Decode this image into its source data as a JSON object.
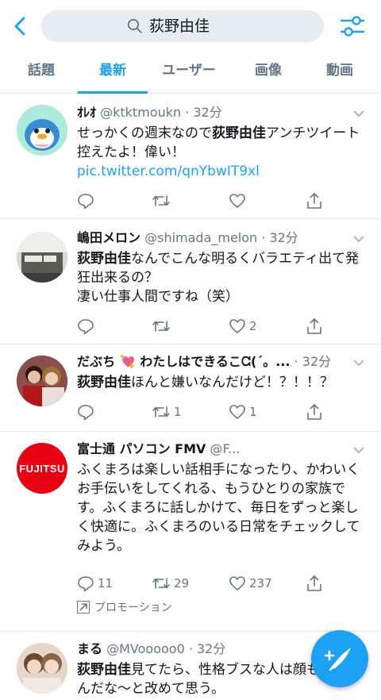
{
  "search": {
    "query": "荻野由佳"
  },
  "tabs": [
    {
      "label": "話題"
    },
    {
      "label": "最新"
    },
    {
      "label": "ユーザー"
    },
    {
      "label": "画像"
    },
    {
      "label": "動画"
    }
  ],
  "tweets": [
    {
      "name": "ｵﾚｵ",
      "meta": "@ktktmoukn · 32分",
      "body_pre": "せっかくの週末なので",
      "body_bold": "荻野由佳",
      "body_post": "アンチツイート控えたよ！偉い！ ",
      "link": "pic.twitter.com/qnYbwIT9xl",
      "likes": "",
      "retweets": "",
      "replies": ""
    },
    {
      "name": "嶋田メロン",
      "meta": "@shimada_melon · 32分",
      "body_bold": "荻野由佳",
      "body_post": "なんでこんな明るくバラエティ出て発狂出来るの？",
      "body_line2": "凄い仕事人間ですね（笑）",
      "likes": "2"
    },
    {
      "name": "だぶち 💘 わたしはできるこᘳ(´。...",
      "meta": " · 32分",
      "body_bold": "荻野由佳",
      "body_post": "ほんと嫌いなんだけど！？！！？",
      "retweets": "1",
      "likes": "1"
    },
    {
      "name": "富士通 パソコン FMV",
      "meta": " @F...",
      "body": "ふくまろは楽しい話相手になったり、かわいくお手伝いをしてくれる、もうひとりの家族です。ふくまろに話しかけて、毎日をずっと楽しく快適に。ふくまろのいる日常をチェックしてみよう。",
      "replies": "11",
      "retweets": "29",
      "likes": "237",
      "promo": "プロモーション",
      "logo_text": "FUJITSU"
    },
    {
      "name": "まる",
      "meta": " @MVooooo0 · 32分",
      "body_bold": "荻野由佳",
      "body_post": "見てたら、性格ブスな人は顔もブスなんだな〜と改めて思う。"
    }
  ],
  "colors": {
    "accent": "#1da1f2",
    "muted": "#657786",
    "border": "#e1e8ed",
    "search_bg": "#e6ecf0",
    "fujitsu_red": "#e60012"
  },
  "icons": [
    "back-chevron-icon",
    "search-icon",
    "filter-sliders-icon",
    "reply-icon",
    "retweet-icon",
    "like-heart-icon",
    "share-icon",
    "compose-tweet-icon",
    "promoted-arrow-icon"
  ]
}
